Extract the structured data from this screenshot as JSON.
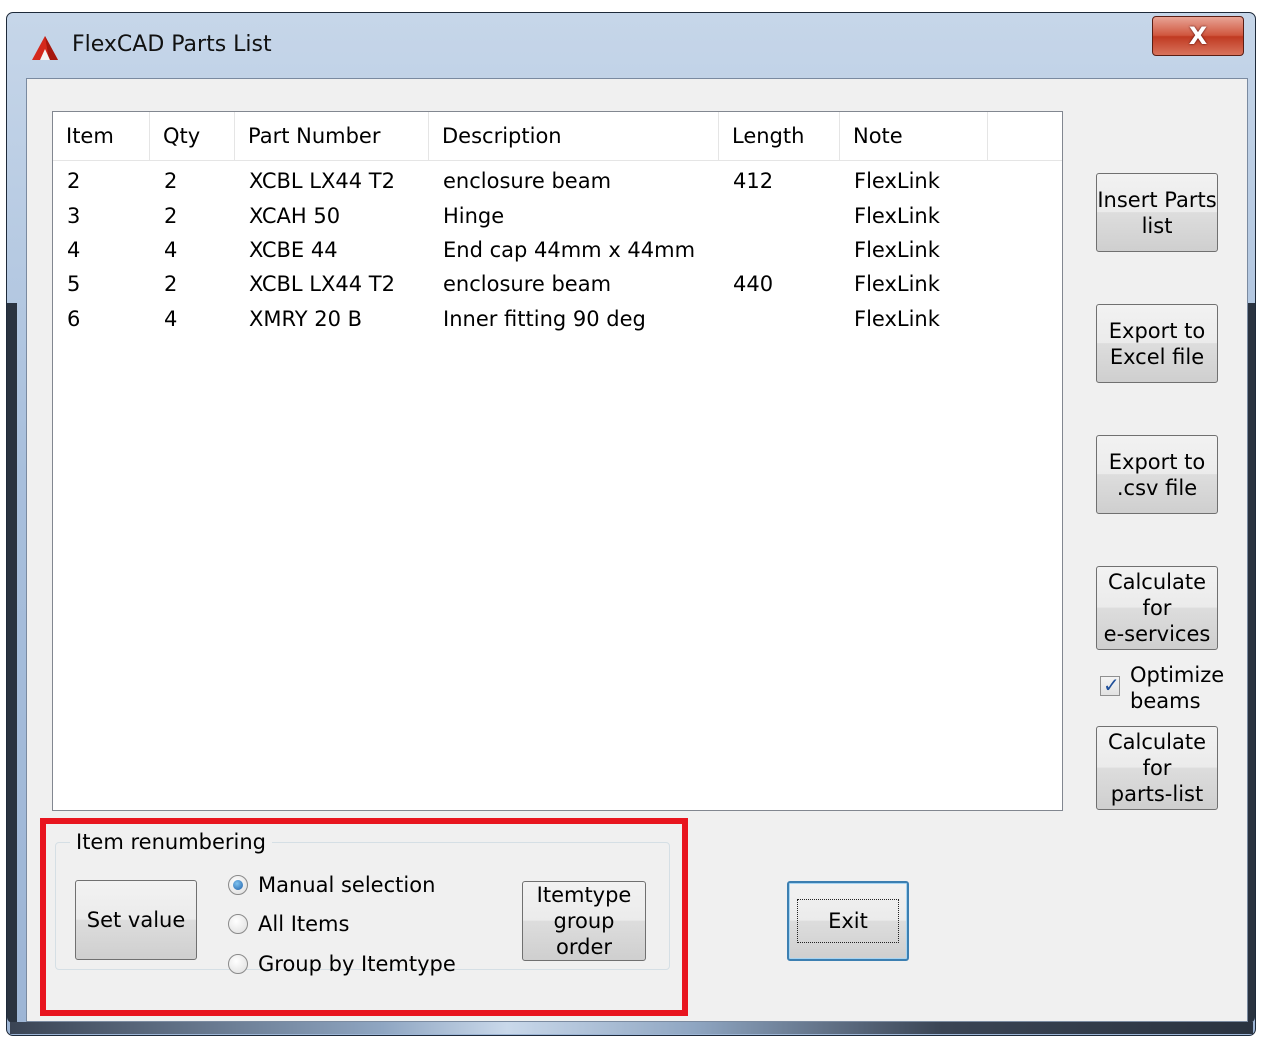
{
  "window": {
    "title": "FlexCAD Parts List",
    "close_label": "X"
  },
  "table": {
    "columns": [
      "Item",
      "Qty",
      "Part Number",
      "Description",
      "Length",
      "Note"
    ],
    "rows": [
      [
        "2",
        "2",
        "XCBL LX44 T2",
        "enclosure beam",
        "412",
        "FlexLink"
      ],
      [
        "3",
        "2",
        "XCAH 50",
        "Hinge",
        "",
        "FlexLink"
      ],
      [
        "4",
        "4",
        "XCBE 44",
        "End cap 44mm x 44mm",
        "",
        "FlexLink"
      ],
      [
        "5",
        "2",
        "XCBL LX44 T2",
        "enclosure beam",
        "440",
        "FlexLink"
      ],
      [
        "6",
        "4",
        "XMRY 20 B",
        "Inner fitting 90 deg",
        "",
        "FlexLink"
      ]
    ]
  },
  "side_buttons": {
    "insert_l1": "Insert Parts",
    "insert_l2": "list",
    "excel_l1": "Export to",
    "excel_l2": "Excel file",
    "csv_l1": "Export to",
    "csv_l2": ".csv file",
    "eservices_l1": "Calculate",
    "eservices_l2": "for",
    "eservices_l3": "e-services",
    "partslist_l1": "Calculate",
    "partslist_l2": "for",
    "partslist_l3": "parts-list"
  },
  "optimize": {
    "label_l1": "Optimize",
    "label_l2": "beams",
    "checked": true
  },
  "renumbering": {
    "title": "Item renumbering",
    "set_value": "Set value",
    "options": [
      "Manual selection",
      "All Items",
      "Group by Itemtype"
    ],
    "selected": "Manual selection",
    "itemtype_l1": "Itemtype",
    "itemtype_l2": "group order"
  },
  "exit_label": "Exit",
  "colors": {
    "highlight": "#e8151f",
    "close": "#c8452d",
    "default_border": "#3c7fb1"
  }
}
